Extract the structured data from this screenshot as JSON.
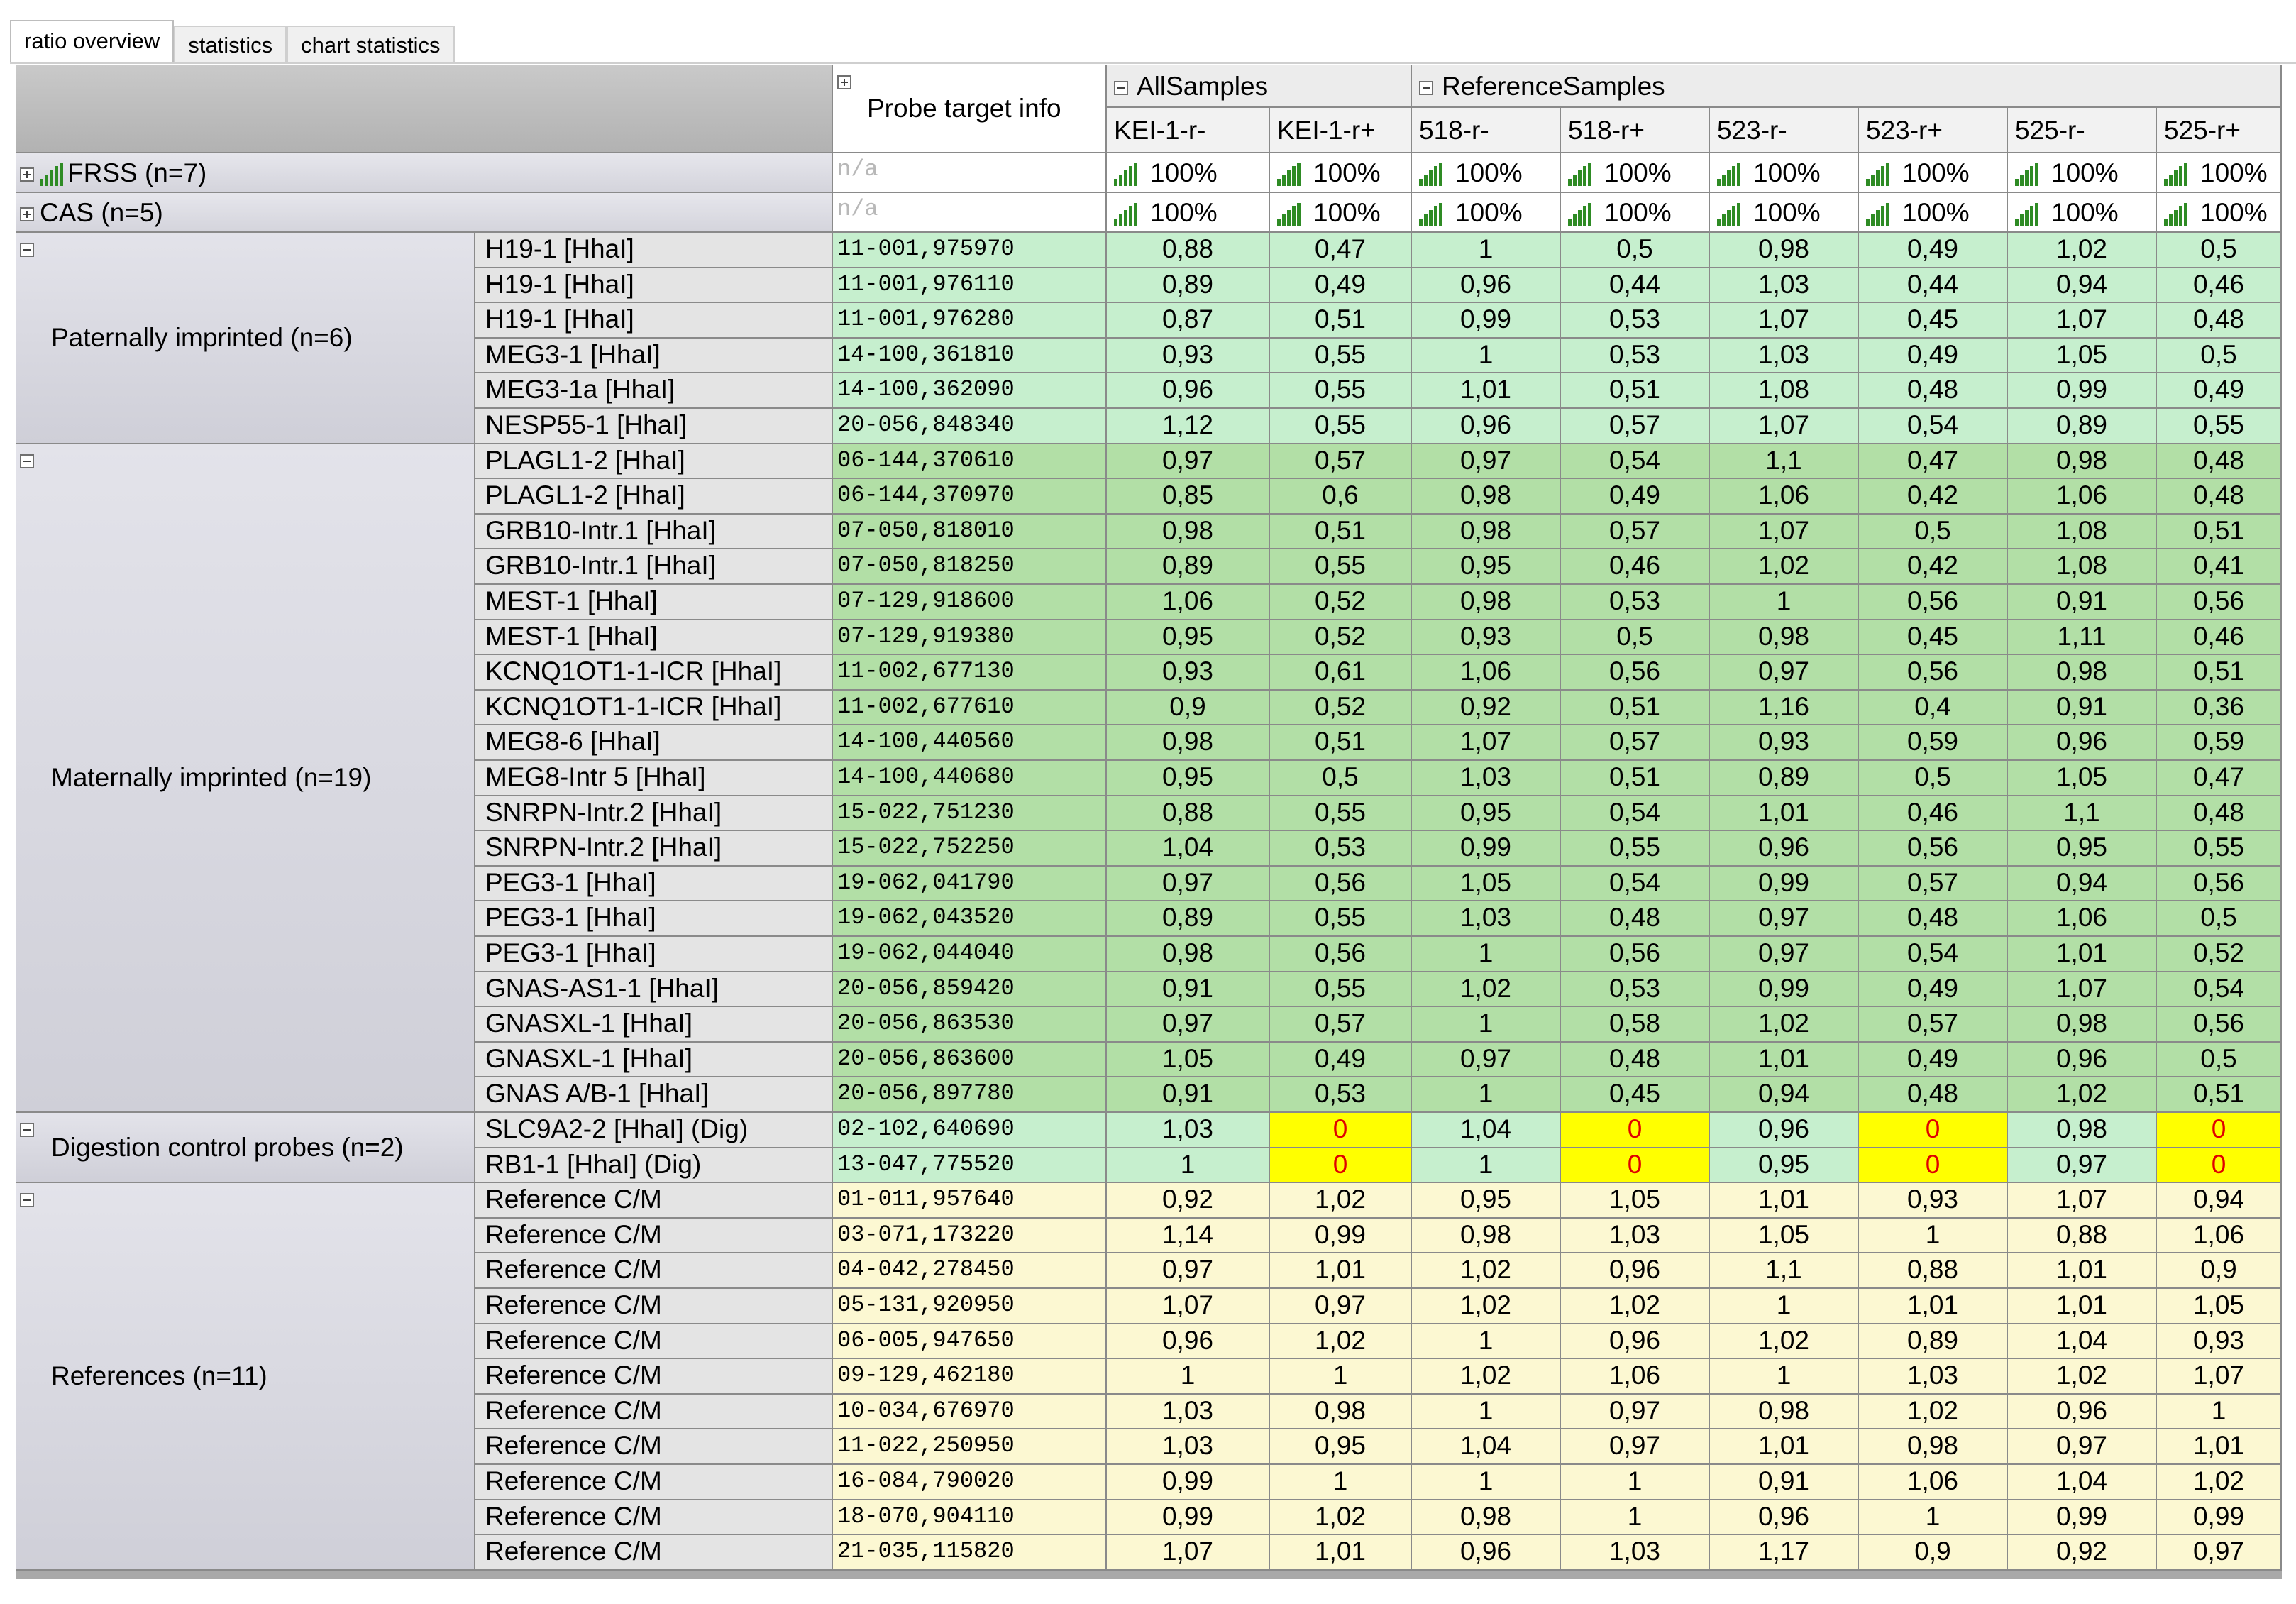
{
  "tabs": [
    "ratio overview",
    "statistics",
    "chart statistics"
  ],
  "active_tab": 0,
  "header": {
    "probe_target_info": "Probe target info",
    "groups": [
      {
        "label": "AllSamples",
        "columns": [
          "KEI-1-r-",
          "KEI-1-r+"
        ]
      },
      {
        "label": "ReferenceSamples",
        "columns": [
          "518-r-",
          "518-r+",
          "523-r-",
          "523-r+",
          "525-r-",
          "525-r+"
        ]
      }
    ]
  },
  "summary_rows": [
    {
      "label": "FRSS (n=7)",
      "info": "n/a",
      "values": [
        "100%",
        "100%",
        "100%",
        "100%",
        "100%",
        "100%",
        "100%",
        "100%"
      ]
    },
    {
      "label": "CAS (n=5)",
      "info": "n/a",
      "values": [
        "100%",
        "100%",
        "100%",
        "100%",
        "100%",
        "100%",
        "100%",
        "100%"
      ]
    }
  ],
  "groups": [
    {
      "label": "Paternally imprinted (n=6)",
      "color": "#c6efce",
      "rows": [
        {
          "probe": "H19-1 [HhaI]",
          "info": "11-001,975970",
          "values": [
            "0,88",
            "0,47",
            "1",
            "0,5",
            "0,98",
            "0,49",
            "1,02",
            "0,5"
          ]
        },
        {
          "probe": "H19-1 [HhaI]",
          "info": "11-001,976110",
          "values": [
            "0,89",
            "0,49",
            "0,96",
            "0,44",
            "1,03",
            "0,44",
            "0,94",
            "0,46"
          ]
        },
        {
          "probe": "H19-1 [HhaI]",
          "info": "11-001,976280",
          "values": [
            "0,87",
            "0,51",
            "0,99",
            "0,53",
            "1,07",
            "0,45",
            "1,07",
            "0,48"
          ]
        },
        {
          "probe": "MEG3-1 [HhaI]",
          "info": "14-100,361810",
          "values": [
            "0,93",
            "0,55",
            "1",
            "0,53",
            "1,03",
            "0,49",
            "1,05",
            "0,5"
          ]
        },
        {
          "probe": "MEG3-1a [HhaI]",
          "info": "14-100,362090",
          "values": [
            "0,96",
            "0,55",
            "1,01",
            "0,51",
            "1,08",
            "0,48",
            "0,99",
            "0,49"
          ]
        },
        {
          "probe": "NESP55-1 [HhaI]",
          "info": "20-056,848340",
          "values": [
            "1,12",
            "0,55",
            "0,96",
            "0,57",
            "1,07",
            "0,54",
            "0,89",
            "0,55"
          ]
        }
      ]
    },
    {
      "label": "Maternally imprinted (n=19)",
      "color": "#b2dfa6",
      "rows": [
        {
          "probe": "PLAGL1-2 [HhaI]",
          "info": "06-144,370610",
          "values": [
            "0,97",
            "0,57",
            "0,97",
            "0,54",
            "1,1",
            "0,47",
            "0,98",
            "0,48"
          ]
        },
        {
          "probe": "PLAGL1-2 [HhaI]",
          "info": "06-144,370970",
          "values": [
            "0,85",
            "0,6",
            "0,98",
            "0,49",
            "1,06",
            "0,42",
            "1,06",
            "0,48"
          ]
        },
        {
          "probe": "GRB10-Intr.1 [HhaI]",
          "info": "07-050,818010",
          "values": [
            "0,98",
            "0,51",
            "0,98",
            "0,57",
            "1,07",
            "0,5",
            "1,08",
            "0,51"
          ]
        },
        {
          "probe": "GRB10-Intr.1 [HhaI]",
          "info": "07-050,818250",
          "values": [
            "0,89",
            "0,55",
            "0,95",
            "0,46",
            "1,02",
            "0,42",
            "1,08",
            "0,41"
          ]
        },
        {
          "probe": "MEST-1 [HhaI]",
          "info": "07-129,918600",
          "values": [
            "1,06",
            "0,52",
            "0,98",
            "0,53",
            "1",
            "0,56",
            "0,91",
            "0,56"
          ]
        },
        {
          "probe": "MEST-1 [HhaI]",
          "info": "07-129,919380",
          "values": [
            "0,95",
            "0,52",
            "0,93",
            "0,5",
            "0,98",
            "0,45",
            "1,11",
            "0,46"
          ]
        },
        {
          "probe": "KCNQ1OT1-1-ICR [HhaI]",
          "info": "11-002,677130",
          "values": [
            "0,93",
            "0,61",
            "1,06",
            "0,56",
            "0,97",
            "0,56",
            "0,98",
            "0,51"
          ]
        },
        {
          "probe": "KCNQ1OT1-1-ICR [HhaI]",
          "info": "11-002,677610",
          "values": [
            "0,9",
            "0,52",
            "0,92",
            "0,51",
            "1,16",
            "0,4",
            "0,91",
            "0,36"
          ]
        },
        {
          "probe": "MEG8-6 [HhaI]",
          "info": "14-100,440560",
          "values": [
            "0,98",
            "0,51",
            "1,07",
            "0,57",
            "0,93",
            "0,59",
            "0,96",
            "0,59"
          ]
        },
        {
          "probe": "MEG8-Intr 5 [HhaI]",
          "info": "14-100,440680",
          "values": [
            "0,95",
            "0,5",
            "1,03",
            "0,51",
            "0,89",
            "0,5",
            "1,05",
            "0,47"
          ]
        },
        {
          "probe": "SNRPN-Intr.2 [HhaI]",
          "info": "15-022,751230",
          "values": [
            "0,88",
            "0,55",
            "0,95",
            "0,54",
            "1,01",
            "0,46",
            "1,1",
            "0,48"
          ]
        },
        {
          "probe": "SNRPN-Intr.2 [HhaI]",
          "info": "15-022,752250",
          "values": [
            "1,04",
            "0,53",
            "0,99",
            "0,55",
            "0,96",
            "0,56",
            "0,95",
            "0,55"
          ]
        },
        {
          "probe": "PEG3-1 [HhaI]",
          "info": "19-062,041790",
          "values": [
            "0,97",
            "0,56",
            "1,05",
            "0,54",
            "0,99",
            "0,57",
            "0,94",
            "0,56"
          ]
        },
        {
          "probe": "PEG3-1 [HhaI]",
          "info": "19-062,043520",
          "values": [
            "0,89",
            "0,55",
            "1,03",
            "0,48",
            "0,97",
            "0,48",
            "1,06",
            "0,5"
          ]
        },
        {
          "probe": "PEG3-1 [HhaI]",
          "info": "19-062,044040",
          "values": [
            "0,98",
            "0,56",
            "1",
            "0,56",
            "0,97",
            "0,54",
            "1,01",
            "0,52"
          ]
        },
        {
          "probe": "GNAS-AS1-1 [HhaI]",
          "info": "20-056,859420",
          "values": [
            "0,91",
            "0,55",
            "1,02",
            "0,53",
            "0,99",
            "0,49",
            "1,07",
            "0,54"
          ]
        },
        {
          "probe": "GNASXL-1 [HhaI]",
          "info": "20-056,863530",
          "values": [
            "0,97",
            "0,57",
            "1",
            "0,58",
            "1,02",
            "0,57",
            "0,98",
            "0,56"
          ]
        },
        {
          "probe": "GNASXL-1 [HhaI]",
          "info": "20-056,863600",
          "values": [
            "1,05",
            "0,49",
            "0,97",
            "0,48",
            "1,01",
            "0,49",
            "0,96",
            "0,5"
          ]
        },
        {
          "probe": "GNAS A/B-1 [HhaI]",
          "info": "20-056,897780",
          "values": [
            "0,91",
            "0,53",
            "1",
            "0,45",
            "0,94",
            "0,48",
            "1,02",
            "0,51"
          ]
        }
      ]
    },
    {
      "label": "Digestion control probes (n=2)",
      "color": "#c6efce",
      "highlight": "#ffff00",
      "rows": [
        {
          "probe": "SLC9A2-2 [HhaI] (Dig)",
          "info": "02-102,640690",
          "values": [
            "1,03",
            "0",
            "1,04",
            "0",
            "0,96",
            "0",
            "0,98",
            "0"
          ]
        },
        {
          "probe": "RB1-1 [HhaI] (Dig)",
          "info": "13-047,775520",
          "values": [
            "1",
            "0",
            "1",
            "0",
            "0,95",
            "0",
            "0,97",
            "0"
          ]
        }
      ]
    },
    {
      "label": "References (n=11)",
      "color": "#fcf8d2",
      "rows": [
        {
          "probe": "Reference C/M",
          "info": "01-011,957640",
          "values": [
            "0,92",
            "1,02",
            "0,95",
            "1,05",
            "1,01",
            "0,93",
            "1,07",
            "0,94"
          ]
        },
        {
          "probe": "Reference C/M",
          "info": "03-071,173220",
          "values": [
            "1,14",
            "0,99",
            "0,98",
            "1,03",
            "1,05",
            "1",
            "0,88",
            "1,06"
          ]
        },
        {
          "probe": "Reference C/M",
          "info": "04-042,278450",
          "values": [
            "0,97",
            "1,01",
            "1,02",
            "0,96",
            "1,1",
            "0,88",
            "1,01",
            "0,9"
          ]
        },
        {
          "probe": "Reference C/M",
          "info": "05-131,920950",
          "values": [
            "1,07",
            "0,97",
            "1,02",
            "1,02",
            "1",
            "1,01",
            "1,01",
            "1,05"
          ]
        },
        {
          "probe": "Reference C/M",
          "info": "06-005,947650",
          "values": [
            "0,96",
            "1,02",
            "1",
            "0,96",
            "1,02",
            "0,89",
            "1,04",
            "0,93"
          ]
        },
        {
          "probe": "Reference C/M",
          "info": "09-129,462180",
          "values": [
            "1",
            "1",
            "1,02",
            "1,06",
            "1",
            "1,03",
            "1,02",
            "1,07"
          ]
        },
        {
          "probe": "Reference C/M",
          "info": "10-034,676970",
          "values": [
            "1,03",
            "0,98",
            "1",
            "0,97",
            "0,98",
            "1,02",
            "0,96",
            "1"
          ]
        },
        {
          "probe": "Reference C/M",
          "info": "11-022,250950",
          "values": [
            "1,03",
            "0,95",
            "1,04",
            "0,97",
            "1,01",
            "0,98",
            "0,97",
            "1,01"
          ]
        },
        {
          "probe": "Reference C/M",
          "info": "16-084,790020",
          "values": [
            "0,99",
            "1",
            "1",
            "1",
            "0,91",
            "1,06",
            "1,04",
            "1,02"
          ]
        },
        {
          "probe": "Reference C/M",
          "info": "18-070,904110",
          "values": [
            "0,99",
            "1,02",
            "0,98",
            "1",
            "0,96",
            "1",
            "0,99",
            "0,99"
          ]
        },
        {
          "probe": "Reference C/M",
          "info": "21-035,115820",
          "values": [
            "1,07",
            "1,01",
            "0,96",
            "1,03",
            "1,17",
            "0,9",
            "0,92",
            "0,97"
          ]
        }
      ]
    }
  ]
}
